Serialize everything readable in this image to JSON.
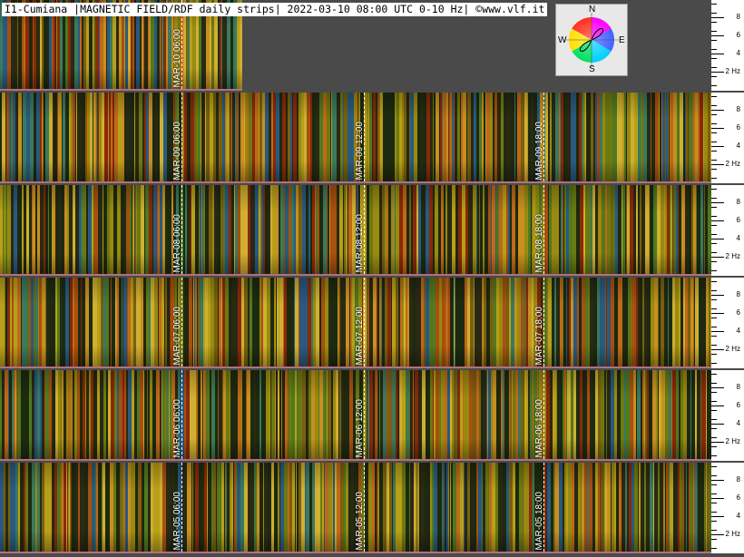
{
  "header_text": "I1-Cumiana |MAGNETIC FIELD/RDF daily strips| 2022-03-10 08:00 UTC 0-10 Hz| ©www.vlf.it",
  "compass": {
    "n": "N",
    "e": "E",
    "s": "S",
    "w": "W"
  },
  "scale_labels": [
    "8",
    "6",
    "4",
    "2 Hz"
  ],
  "strips": [
    {
      "id": "mar10",
      "markers": [
        "MAR-10 06:00"
      ]
    },
    {
      "id": "mar09",
      "markers": [
        "MAR-09 06:00",
        "MAR-09 12:00",
        "MAR-09 18:00"
      ]
    },
    {
      "id": "mar08",
      "markers": [
        "MAR-08 06:00",
        "MAR-08 12:00",
        "MAR-08 18:00"
      ]
    },
    {
      "id": "mar07",
      "markers": [
        "MAR-07 06:00",
        "MAR-07 12:00",
        "MAR-07 18:00"
      ]
    },
    {
      "id": "mar06",
      "markers": [
        "MAR-06 06:00",
        "MAR-06 12:00",
        "MAR-06 18:00"
      ]
    },
    {
      "id": "mar05",
      "markers": [
        "MAR-05 06:00",
        "MAR-05 12:00",
        "MAR-05 18:00"
      ]
    }
  ]
}
